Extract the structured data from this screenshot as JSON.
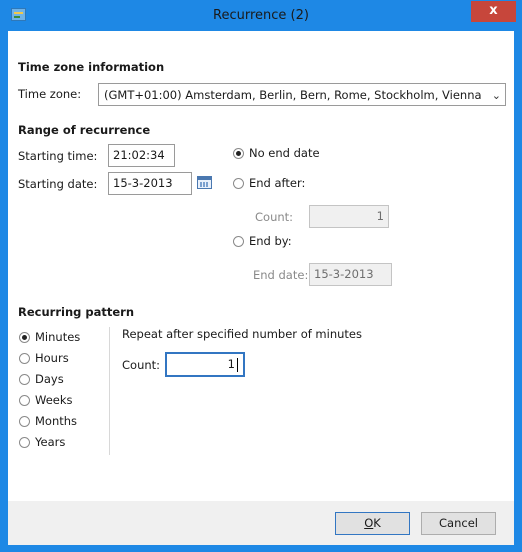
{
  "window": {
    "title": "Recurrence (2)",
    "close_label": "x"
  },
  "timezone": {
    "header": "Time zone information",
    "label": "Time zone:",
    "value": "(GMT+01:00) Amsterdam, Berlin, Bern, Rome, Stockholm, Vienna"
  },
  "range": {
    "header": "Range of recurrence",
    "starting_time_label": "Starting time:",
    "starting_time_value": "21:02:34",
    "starting_date_label": "Starting date:",
    "starting_date_value": "15-3-2013",
    "no_end_date_label": "No end date",
    "end_after_label": "End after:",
    "count_label": "Count:",
    "count_value": "1",
    "end_by_label": "End by:",
    "end_date_label": "End date:",
    "end_date_value": "15-3-2013",
    "selected": "No end date"
  },
  "pattern": {
    "header": "Recurring pattern",
    "options": [
      "Minutes",
      "Hours",
      "Days",
      "Weeks",
      "Months",
      "Years"
    ],
    "selected": "Minutes",
    "description": "Repeat after specified number of minutes",
    "count_label": "Count:",
    "count_value": "1"
  },
  "buttons": {
    "ok_accel": "O",
    "ok_rest": "K",
    "cancel": "Cancel"
  }
}
